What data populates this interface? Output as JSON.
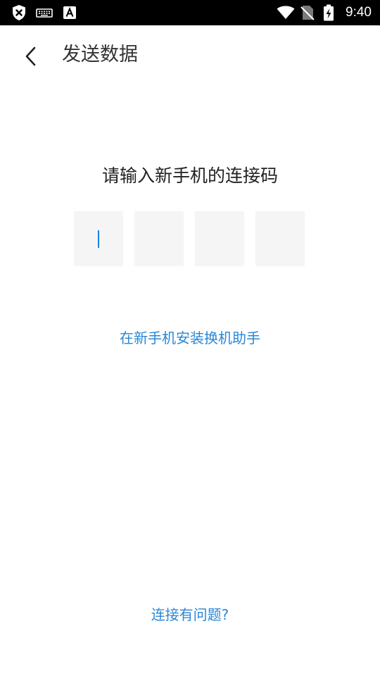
{
  "status_bar": {
    "time": "9:40",
    "icons": [
      "shield-x-icon",
      "keyboard-icon",
      "font-a-icon",
      "wifi-icon",
      "no-sim-icon",
      "battery-charging-icon"
    ]
  },
  "app_bar": {
    "back_icon": "chevron-left-icon",
    "title": "发送数据"
  },
  "main": {
    "prompt": "请输入新手机的连接码",
    "code_inputs": [
      "",
      "",
      "",
      ""
    ],
    "install_link": "在新手机安装换机助手",
    "help_link": "连接有问题?"
  },
  "colors": {
    "accent": "#2a86d6",
    "cursor": "#1e7fe0",
    "box_bg": "#f5f5f5"
  }
}
